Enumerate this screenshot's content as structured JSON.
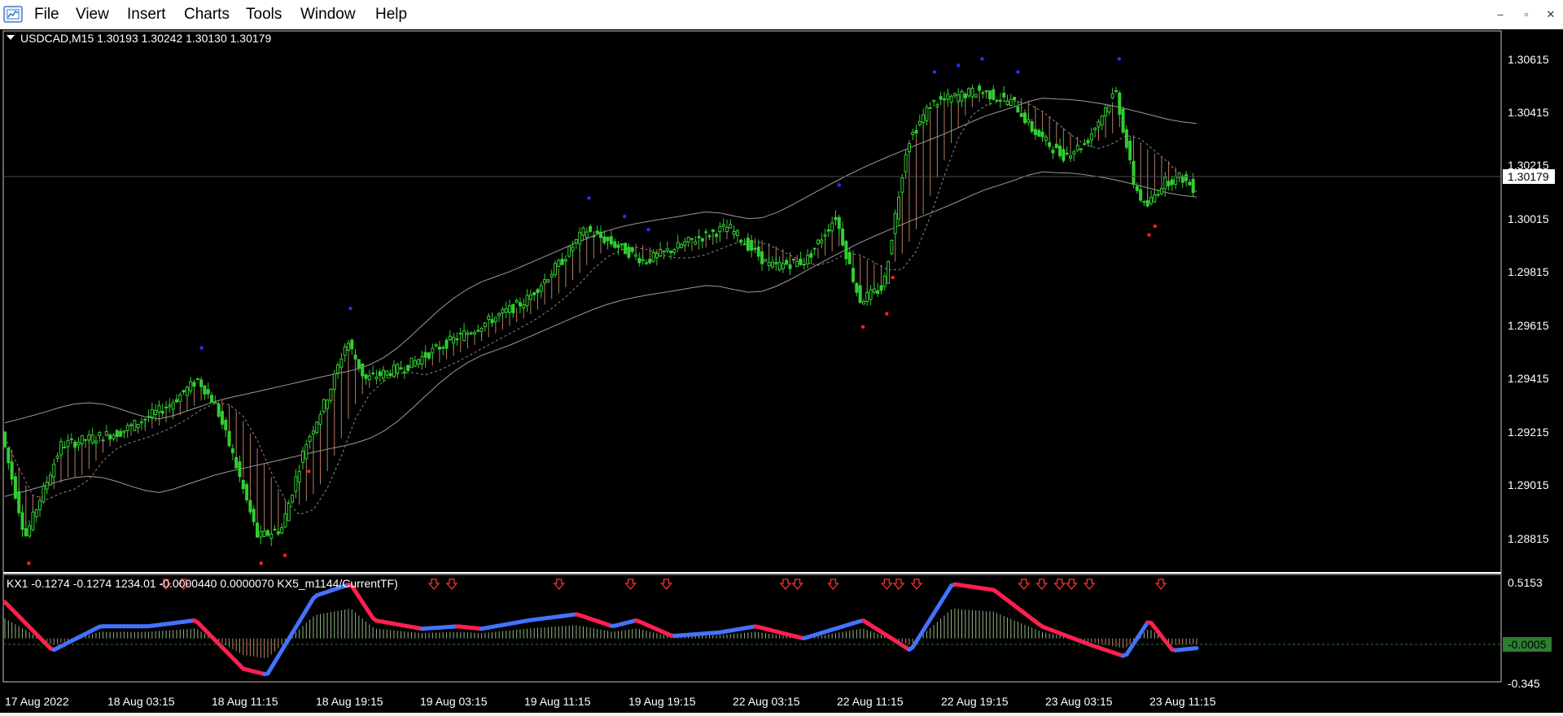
{
  "menu": {
    "items": [
      "File",
      "View",
      "Insert",
      "Charts",
      "Tools",
      "Window",
      "Help"
    ]
  },
  "window_controls": {
    "minimize": "–",
    "restore": "▫",
    "close": "✕"
  },
  "main_chart": {
    "header": "USDCAD,M15  1.30193 1.30242 1.30130 1.30179",
    "price_labels": [
      "1.30615",
      "1.30415",
      "1.30215",
      "1.30015",
      "1.29815",
      "1.29615",
      "1.29415",
      "1.29215",
      "1.29015",
      "1.28815"
    ],
    "current_price": "1.30179"
  },
  "indicator": {
    "header": "KX1 -0.1274 -0.1274  1234.01 -0.0000440 0.0000070  KX5_m1144/CurrentTF)",
    "scale_labels": [
      "0.5153",
      "-0.0005",
      "-0.345"
    ]
  },
  "time_axis": [
    "17 Aug 2022",
    "18 Aug 03:15",
    "18 Aug 11:15",
    "18 Aug 19:15",
    "19 Aug 03:15",
    "19 Aug 11:15",
    "19 Aug 19:15",
    "22 Aug 03:15",
    "22 Aug 11:15",
    "22 Aug 19:15",
    "23 Aug 03:15",
    "23 Aug 11:15"
  ],
  "colors": {
    "background": "#000000",
    "candle": "#32cd32",
    "histogram": "#f4a582",
    "blue_line": "#4472ff",
    "red_line": "#ff2050",
    "arrow": "#ff3030",
    "axis_text": "#ffffff"
  },
  "icons": {
    "app": "metatrader-icon",
    "arrow": "down-arrow-icon"
  },
  "chart_data": {
    "type": "line",
    "symbol": "USDCAD",
    "timeframe": "M15",
    "ylim": [
      1.2872,
      1.3077
    ],
    "price_path": [
      [
        0.0,
        1.2925
      ],
      [
        0.02,
        1.2885
      ],
      [
        0.05,
        1.292
      ],
      [
        0.1,
        1.2925
      ],
      [
        0.14,
        1.2935
      ],
      [
        0.165,
        1.2945
      ],
      [
        0.18,
        1.2935
      ],
      [
        0.195,
        1.2915
      ],
      [
        0.215,
        1.2885
      ],
      [
        0.235,
        1.2888
      ],
      [
        0.255,
        1.292
      ],
      [
        0.275,
        1.294
      ],
      [
        0.29,
        1.296
      ],
      [
        0.305,
        1.2945
      ],
      [
        0.34,
        1.295
      ],
      [
        0.37,
        1.2958
      ],
      [
        0.4,
        1.2965
      ],
      [
        0.44,
        1.2975
      ],
      [
        0.47,
        1.299
      ],
      [
        0.49,
        1.3002
      ],
      [
        0.52,
        1.2995
      ],
      [
        0.54,
        1.299
      ],
      [
        0.58,
        1.2998
      ],
      [
        0.61,
        1.3003
      ],
      [
        0.645,
        1.2988
      ],
      [
        0.675,
        1.299
      ],
      [
        0.7,
        1.3007
      ],
      [
        0.72,
        1.2975
      ],
      [
        0.74,
        1.298
      ],
      [
        0.76,
        1.3035
      ],
      [
        0.78,
        1.305
      ],
      [
        0.82,
        1.3055
      ],
      [
        0.85,
        1.305
      ],
      [
        0.865,
        1.304
      ],
      [
        0.89,
        1.303
      ],
      [
        0.91,
        1.3035
      ],
      [
        0.935,
        1.3055
      ],
      [
        0.95,
        1.302
      ],
      [
        0.96,
        1.301
      ],
      [
        0.975,
        1.302
      ],
      [
        0.99,
        1.3022
      ],
      [
        1.0,
        1.3018
      ]
    ],
    "indicator_path": [
      [
        0.0,
        0.3
      ],
      [
        0.04,
        -0.1
      ],
      [
        0.08,
        0.1
      ],
      [
        0.12,
        0.1
      ],
      [
        0.16,
        0.15
      ],
      [
        0.2,
        -0.25
      ],
      [
        0.22,
        -0.3
      ],
      [
        0.26,
        0.35
      ],
      [
        0.29,
        0.45
      ],
      [
        0.31,
        0.15
      ],
      [
        0.35,
        0.08
      ],
      [
        0.38,
        0.1
      ],
      [
        0.4,
        0.08
      ],
      [
        0.44,
        0.15
      ],
      [
        0.48,
        0.2
      ],
      [
        0.51,
        0.1
      ],
      [
        0.53,
        0.15
      ],
      [
        0.56,
        0.02
      ],
      [
        0.6,
        0.05
      ],
      [
        0.63,
        0.1
      ],
      [
        0.67,
        0.0
      ],
      [
        0.72,
        0.15
      ],
      [
        0.76,
        -0.1
      ],
      [
        0.795,
        0.45
      ],
      [
        0.83,
        0.4
      ],
      [
        0.87,
        0.1
      ],
      [
        0.91,
        -0.05
      ],
      [
        0.94,
        -0.15
      ],
      [
        0.96,
        0.15
      ],
      [
        0.98,
        -0.1
      ],
      [
        1.0,
        -0.08
      ]
    ],
    "indicator_ylim": [
      -0.345,
      0.5153
    ]
  }
}
